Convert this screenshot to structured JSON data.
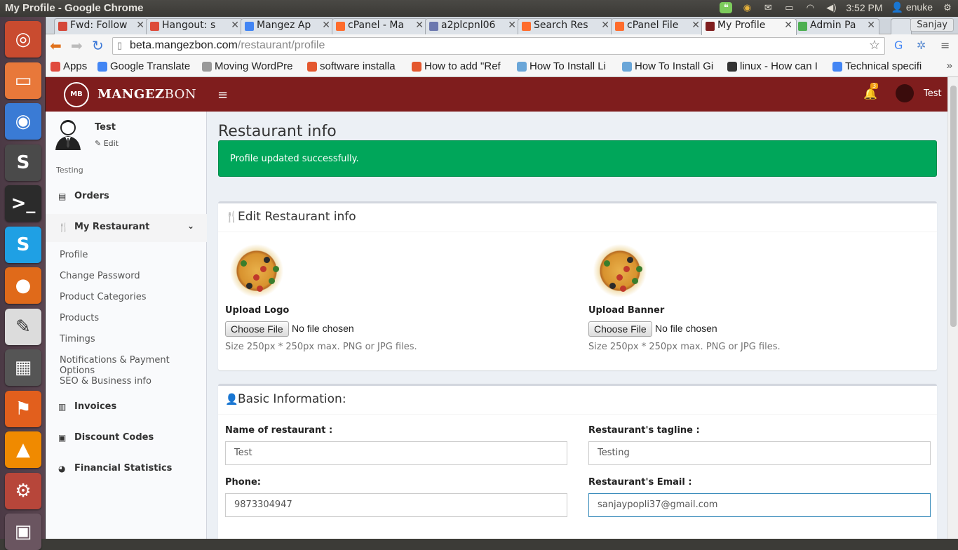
{
  "os": {
    "window_title": "My Profile - Google Chrome",
    "clock": "3:52 PM",
    "user": "enuke",
    "launcher": [
      {
        "name": "ubuntu-dash-icon",
        "color": "#c94b2f",
        "glyph": "◎"
      },
      {
        "name": "files-icon",
        "color": "#e8783a",
        "glyph": "▭"
      },
      {
        "name": "chrome-icon",
        "color": "#3a7bd5",
        "glyph": "◉"
      },
      {
        "name": "sublime-text-icon",
        "color": "#4a4a4a",
        "glyph": "S"
      },
      {
        "name": "terminal-icon",
        "color": "#2b2b2b",
        "glyph": ">_"
      },
      {
        "name": "skype-icon",
        "color": "#1fa0e4",
        "glyph": "S"
      },
      {
        "name": "firefox-icon",
        "color": "#e06a1a",
        "glyph": "●"
      },
      {
        "name": "text-editor-icon",
        "color": "#dcdcdc",
        "glyph": "✎"
      },
      {
        "name": "calculator-icon",
        "color": "#555",
        "glyph": "▦"
      },
      {
        "name": "software-center-icon",
        "color": "#e25f1d",
        "glyph": "⚑"
      },
      {
        "name": "vlc-icon",
        "color": "#f08a00",
        "glyph": "▲"
      },
      {
        "name": "system-settings-icon",
        "color": "#b7463a",
        "glyph": "⚙"
      },
      {
        "name": "workspace-icon",
        "color": "#6a5560",
        "glyph": "▣"
      }
    ]
  },
  "browser": {
    "tabs": [
      {
        "label": "Fwd: Follow",
        "fav": "#d44638"
      },
      {
        "label": "Hangout: s",
        "fav": "#dd4b39"
      },
      {
        "label": "Mangez Ap",
        "fav": "#4285f4"
      },
      {
        "label": "cPanel - Ma",
        "fav": "#ff6c2c"
      },
      {
        "label": "a2plcpnl06",
        "fav": "#6c78af"
      },
      {
        "label": "Search Res",
        "fav": "#ff6c2c"
      },
      {
        "label": "cPanel File",
        "fav": "#ff6c2c"
      },
      {
        "label": "My Profile",
        "fav": "#7f1d1d"
      },
      {
        "label": "Admin Pa",
        "fav": "#4caf50"
      }
    ],
    "profile_name": "Sanjay",
    "url_host": "beta.mangezbon.com",
    "url_path": "/restaurant/profile",
    "bookmarks": [
      {
        "label": "Apps",
        "color": "#e04b3f"
      },
      {
        "label": "Google Translate",
        "color": "#4285f4"
      },
      {
        "label": "Moving WordPre",
        "color": "#999"
      },
      {
        "label": "software installa",
        "color": "#e4572e"
      },
      {
        "label": "How to add \"Ref",
        "color": "#e4572e"
      },
      {
        "label": "How To Install Li",
        "color": "#6aa6d8"
      },
      {
        "label": "How To Install Gi",
        "color": "#6aa6d8"
      },
      {
        "label": "linux - How can I",
        "color": "#333"
      },
      {
        "label": "Technical specifi",
        "color": "#4285f4"
      }
    ]
  },
  "app": {
    "brand_bold": "MANGEZ",
    "brand_light": "BON",
    "logo_mark": "MB",
    "notification_count": "3",
    "header_user": "Test",
    "sidebar": {
      "user_name": "Test",
      "edit_label": "Edit",
      "tagline": "Testing",
      "menu": [
        {
          "label": "Orders",
          "icon": "▤"
        },
        {
          "label": "My Restaurant",
          "icon": "🍴"
        },
        {
          "label": "Invoices",
          "icon": "▥"
        },
        {
          "label": "Discount Codes",
          "icon": "▣"
        },
        {
          "label": "Financial Statistics",
          "icon": "◕"
        }
      ],
      "submenu": [
        "Profile",
        "Change Password",
        "Product Categories",
        "Products",
        "Timings",
        "Notifications & Payment Options",
        "SEO & Business info"
      ]
    },
    "content": {
      "title": "Restaurant info",
      "alert": "Profile updated successfully.",
      "edit_box": {
        "title": "Edit Restaurant info",
        "logo_label": "Upload Logo",
        "banner_label": "Upload Banner",
        "choose_file": "Choose File",
        "no_file": "No file chosen",
        "help": "Size 250px * 250px max. PNG or JPG files."
      },
      "basic_box": {
        "title": "Basic Information:",
        "name_label": "Name of restaurant :",
        "name_value": "Test",
        "tagline_label": "Restaurant's tagline :",
        "tagline_value": "Testing",
        "phone_label": "Phone:",
        "phone_value": "9873304947",
        "email_label": "Restaurant's Email :",
        "email_value": "sanjaypopli37@gmail.com"
      }
    }
  },
  "colors": {
    "header": "#7f1d1d",
    "alert": "#00a65a",
    "focus": "#3c8dbc"
  }
}
